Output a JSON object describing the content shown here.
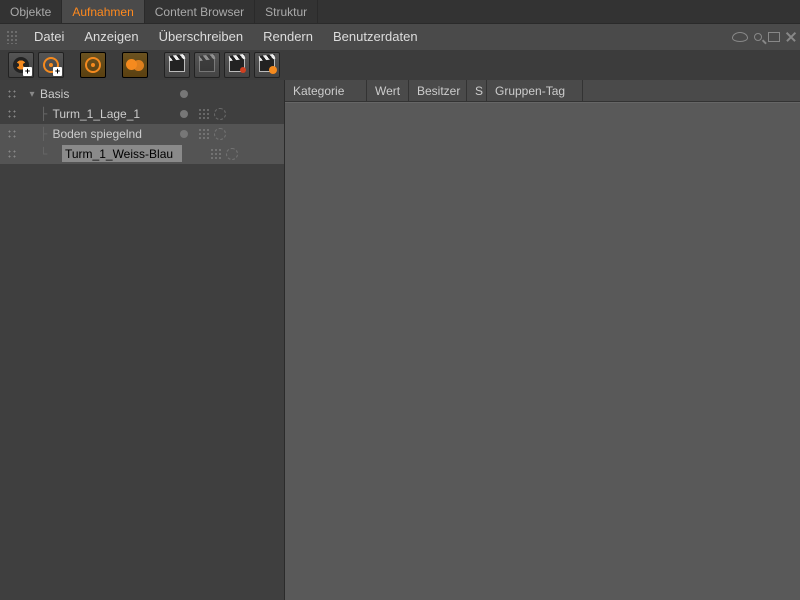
{
  "tabs": [
    {
      "label": "Objekte"
    },
    {
      "label": "Aufnahmen",
      "active": true
    },
    {
      "label": "Content Browser"
    },
    {
      "label": "Struktur"
    }
  ],
  "menu": {
    "items": [
      "Datei",
      "Anzeigen",
      "Überschreiben",
      "Rendern",
      "Benutzerdaten"
    ]
  },
  "toolbar_groups": [
    [
      "reel-add",
      "camera-add"
    ],
    [
      "camera-target"
    ],
    [
      "circles-overlap"
    ],
    [
      "slate",
      "slate-dim",
      "slate-red",
      "slate-reel"
    ]
  ],
  "tree": {
    "root": {
      "label": "Basis",
      "expanded": true,
      "children": [
        {
          "label": "Turm_1_Lage_1"
        },
        {
          "label": "Boden spiegelnd",
          "selected": true
        },
        {
          "label": "Turm_1_Weiss-Blau",
          "editing": true,
          "selected": true
        }
      ]
    }
  },
  "right_panel": {
    "columns": [
      "Kategorie",
      "Wert",
      "Besitzer",
      "S",
      "Gruppen-Tag"
    ]
  }
}
